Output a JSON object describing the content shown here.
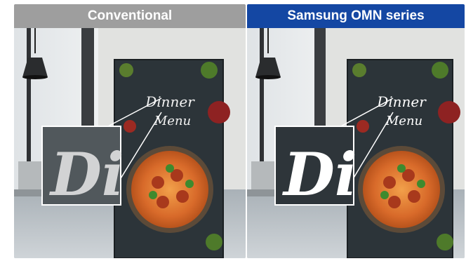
{
  "panels": [
    {
      "title": "Conventional",
      "header_color": "#9e9e9e"
    },
    {
      "title": "Samsung OMN series",
      "header_color": "#1447a3"
    }
  ],
  "icons": [
    "pendant-lamp",
    "wall-display",
    "menu-text",
    "pasta-plate",
    "magnifier-inset"
  ]
}
